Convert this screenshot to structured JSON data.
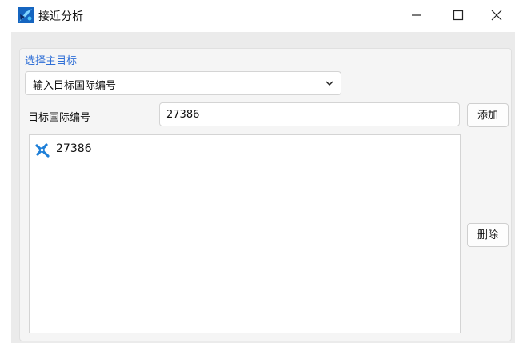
{
  "window": {
    "title": "接近分析"
  },
  "group": {
    "title": "选择主目标"
  },
  "mode_select": {
    "value": "输入目标国际编号"
  },
  "target_id": {
    "label": "目标国际编号",
    "value": "27386"
  },
  "buttons": {
    "add": "添加",
    "delete": "删除"
  },
  "targets": [
    {
      "id": "27386",
      "icon": "satellite-icon"
    }
  ],
  "colors": {
    "accent": "#2f6fd6",
    "satellite_icon": "#1e7fd8"
  }
}
